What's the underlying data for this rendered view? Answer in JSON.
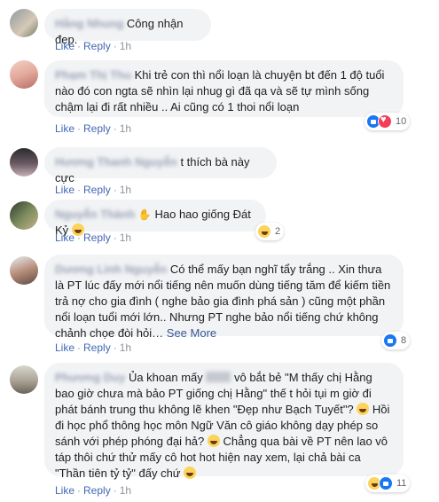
{
  "comments": [
    {
      "name": "Hằng Nhung",
      "text": "Công nhận đẹp.",
      "like": "Like",
      "reply": "Reply",
      "time": "1h"
    },
    {
      "name": "Phạm Thị Thu",
      "text": "Khi trẻ con thì nổi loạn là chuyện bt đến 1 độ tuổi nào đó con ngta sẽ nhìn lại nhug gì đã qa và sẽ tự mình sống chậm lại đi rất nhiều .. Ai cũng có 1 thoi nổi loạn",
      "like": "Like",
      "reply": "Reply",
      "time": "1h",
      "reactions": {
        "count": "10"
      }
    },
    {
      "name": "Hương Thanh Nguyễn",
      "text": "t thích bà này cực",
      "like": "Like",
      "reply": "Reply",
      "time": "1h"
    },
    {
      "name": "Nguyễn Thành",
      "text": "Hao hao giống Đát Kỷ",
      "like": "Like",
      "reply": "Reply",
      "time": "1h",
      "reactions": {
        "count": "2"
      }
    },
    {
      "name": "Dương Linh Nguyễn",
      "text": "Có thể mấy bạn nghĩ tẩy trắng .. Xin thưa là PT lúc đấy mới nổi tiếng nên muốn dùng tiếng tăm để kiếm tiền trả nợ cho gia đình ( nghe bảo gia đình phá sản ) cũng một phần nổi loạn tuổi mới lớn.. Nhưng PT nghe bảo nổi tiếng chứ không chảnh chọe đòi hỏi…",
      "see_more": "See More",
      "like": "Like",
      "reply": "Reply",
      "time": "1h",
      "reactions": {
        "count": "8"
      }
    },
    {
      "name": "Phương Duy",
      "text_parts": [
        "Ủa khoan mấy",
        "vô bắt bẻ \"M thấy chị Hằng bao giờ chưa mà bảo PT giống chị Hằng\" thế t hỏi tụi m giờ đi phát bánh trung thu không lẽ khen \"Đẹp như Bạch Tuyết\"?",
        "Hồi đi học phổ thông học môn Ngữ Văn cô giáo không dạy phép so sánh với phép phóng đại hả?",
        "Chẳng qua bài về PT nên lao vô táp thôi chứ thử mấy cô hot hot hiện nay xem, lại chả bài ca \"Thần tiên tỷ tỷ\" đấy chứ"
      ],
      "like": "Like",
      "reply": "Reply",
      "time": "1h",
      "reactions": {
        "count": "11"
      }
    }
  ],
  "colors": {
    "link": "#4267b2",
    "meta": "#8d949e",
    "bubble": "#f2f3f5"
  }
}
